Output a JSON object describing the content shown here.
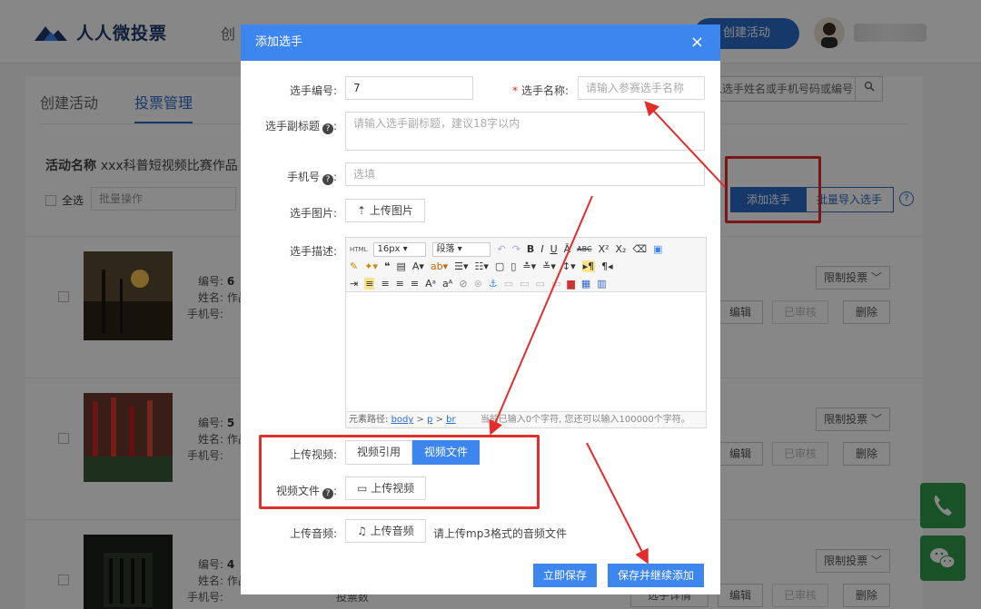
{
  "header": {
    "logo_text": "人人微投票",
    "nav_create": "创",
    "create_button": "创建活动"
  },
  "tabs": [
    {
      "label": "创建活动"
    },
    {
      "label": "投票管理"
    }
  ],
  "activity": {
    "label": "活动名称",
    "name": "xxx科普短视频比赛作品"
  },
  "toolbar": {
    "select_all": "全选",
    "batch_ops": "批量操作",
    "search_placeholder": "输入选手姓名或手机号码或编号",
    "add_player": "添加选手",
    "batch_import": "批量导入选手",
    "help": "?"
  },
  "players": [
    {
      "no_label": "编号:",
      "no": "6",
      "name_label": "姓名: 作品",
      "phone_label": "手机号:"
    },
    {
      "no_label": "编号:",
      "no": "5",
      "name_label": "姓名: 作品",
      "phone_label": "手机号:"
    },
    {
      "no_label": "编号:",
      "no": "4",
      "name_label": "姓名: 作品",
      "phone_label": "手机号:",
      "votes_label": "投票数"
    }
  ],
  "row_actions": {
    "limit_vote": "限制投票",
    "edit": "编辑",
    "reviewed": "已审核",
    "delete": "删除",
    "player_detail": "选手详情"
  },
  "modal": {
    "title": "添加选手",
    "close": "×",
    "number_label": "选手编号:",
    "number_value": "7",
    "name_label": "选手名称:",
    "name_placeholder": "请输入参赛选手名称",
    "subtitle_label": "选手副标题",
    "subtitle_placeholder": "请输入选手副标题，建议18字以内",
    "phone_label": "手机号",
    "phone_placeholder": "选填",
    "image_label": "选手图片:",
    "upload_image": "上传图片",
    "desc_label": "选手描述:",
    "editor": {
      "html_btn": "HTML",
      "font_size": "16px",
      "paragraph": "段落",
      "path_label": "元素路径:",
      "path_body": "body",
      "path_p": "p",
      "path_br": "br",
      "char_count": "当前已输入0个字符, 您还可以输入100000个字符。"
    },
    "video_label": "上传视频:",
    "video_tabs": [
      "视频引用",
      "视频文件"
    ],
    "video_file_label": "视频文件",
    "upload_video": "上传视频",
    "audio_label": "上传音频:",
    "upload_audio": "上传音频",
    "audio_note": "请上传mp3格式的音频文件",
    "save": "立即保存",
    "save_continue": "保存并继续添加"
  },
  "colors": {
    "primary": "#3d85ef",
    "highlight": "#e22d2d",
    "float_green": "#2e9b48"
  }
}
